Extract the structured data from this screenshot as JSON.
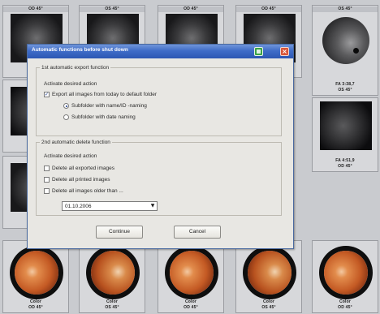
{
  "background_tiles": {
    "top_row_labels": [
      "OD 45°",
      "OS 45°",
      "OD 45°",
      "OD 45°",
      "OS 45°"
    ],
    "right_column_captions": [
      {
        "line1": "FA 3:38,7",
        "line2": "OS 45°"
      },
      {
        "line1": "FA 4:51,9",
        "line2": "OD 45°"
      }
    ],
    "bottom_row_captions": [
      {
        "line1": "Color",
        "line2": "OD 45°"
      },
      {
        "line1": "Color",
        "line2": "OS 45°"
      },
      {
        "line1": "Color",
        "line2": "OD 45°"
      },
      {
        "line1": "Color",
        "line2": "OS 45°"
      },
      {
        "line1": "Color",
        "line2": "OD 45°"
      }
    ]
  },
  "dialog": {
    "title": "Automatic functions before shut down",
    "help_icon": "green-help-icon",
    "close_icon": "close-x-icon",
    "group1": {
      "legend": "1st automatic export function",
      "activate_label": "Activate desired action",
      "export_all_label": "Export all images from today to default folder",
      "export_all_checked": true,
      "radio_name_id": "Subfolder with name/ID -naming",
      "radio_name_id_selected": true,
      "radio_date": "Subfolder with date naming",
      "radio_date_selected": false
    },
    "group2": {
      "legend": "2nd automatic delete function",
      "activate_label": "Activate desired action",
      "delete_exported_label": "Delete all exported images",
      "delete_printed_label": "Delete all printed images",
      "delete_older_label": "Delete all images older than ...",
      "date_value": "01.10.2006"
    },
    "buttons": {
      "continue_label": "Continue",
      "cancel_label": "Cancel"
    }
  },
  "colors": {
    "titlebar": "#3f6cc8",
    "dialog_bg": "#e8e7e3",
    "accent_check": "#1a3a8a"
  }
}
